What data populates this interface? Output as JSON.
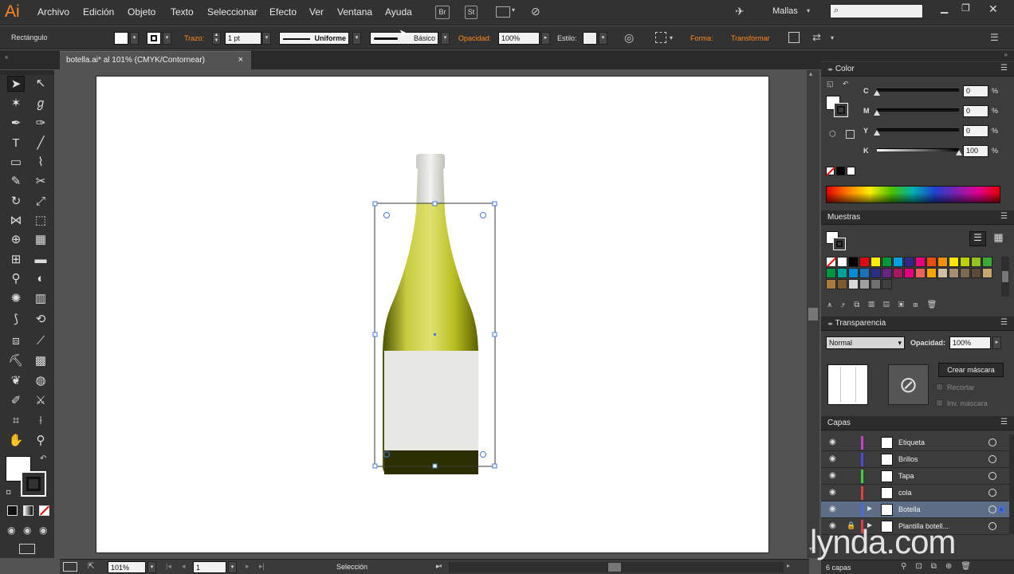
{
  "app": {
    "logo": "Ai"
  },
  "menu": [
    "Archivo",
    "Edición",
    "Objeto",
    "Texto",
    "Seleccionar",
    "Efecto",
    "Ver",
    "Ventana",
    "Ayuda"
  ],
  "menubar_buttons": {
    "bridge": "Br",
    "stock": "St"
  },
  "workspace": "Mallas",
  "control": {
    "object_type": "Rectángulo",
    "stroke_label": "Trazo:",
    "stroke_weight": "1 pt",
    "profile": "Uniforme",
    "brush": "Básico",
    "opacity_label": "Opacidad:",
    "opacity_value": "100%",
    "style_label": "Estilo:",
    "shape_label": "Forma:",
    "transform_label": "Transformar"
  },
  "document_tab": {
    "title": "botella.ai* al 101% (CMYK/Contornear)",
    "close": "×"
  },
  "status": {
    "zoom": "101%",
    "artboard": "1",
    "tool": "Selección"
  },
  "color_panel": {
    "title": "Color",
    "channels": [
      {
        "label": "C",
        "value": "0",
        "pct": 0
      },
      {
        "label": "M",
        "value": "0",
        "pct": 0
      },
      {
        "label": "Y",
        "value": "0",
        "pct": 0
      },
      {
        "label": "K",
        "value": "100",
        "pct": 100
      }
    ],
    "unit": "%"
  },
  "swatches_panel": {
    "title": "Muestras",
    "colors": [
      "#ffffff",
      "#000000",
      "#e30613",
      "#ffed00",
      "#009640",
      "#00a0e3",
      "#312783",
      "#e6007e",
      "#e84e0f",
      "#f39200",
      "#ffe500",
      "#bcd200",
      "#95c11f",
      "#3aaa35",
      "#009640",
      "#00a19a",
      "#008bd2",
      "#1d71b8",
      "#2d2e83",
      "#662483",
      "#a3195b",
      "#e6007e",
      "#ec6459",
      "#f7a600",
      "#cec0a4",
      "#a68e72",
      "#7d6a52",
      "#5b4a3a",
      "#c9a66b",
      "#a87b3f",
      "#7d5a2e",
      "#d8d8d8",
      "#a0a0a0",
      "#707070",
      "#404040"
    ]
  },
  "transparency_panel": {
    "title": "Transparencia",
    "mode": "Normal",
    "opacity_label": "Opacidad:",
    "opacity_value": "100%",
    "make_mask": "Crear máscara",
    "clip": "Recortar",
    "invert": "Inv. máscara"
  },
  "layers_panel": {
    "title": "Capas",
    "layers": [
      {
        "name": "Etiqueta",
        "color": "#c840c8",
        "selected": false
      },
      {
        "name": "Brillos",
        "color": "#4a4ae0",
        "selected": false
      },
      {
        "name": "Tapa",
        "color": "#40d040",
        "selected": false
      },
      {
        "name": "cola",
        "color": "#e04040",
        "selected": false
      },
      {
        "name": "Botella",
        "color": "#4a6ae0",
        "selected": true
      },
      {
        "name": "Plantilla botell...",
        "color": "#e04040",
        "selected": false
      }
    ],
    "count": "6 capas"
  },
  "watermark": "lynda.com",
  "colors": {
    "accent": "#ff8a1f",
    "selection": "#4a7ad8"
  }
}
